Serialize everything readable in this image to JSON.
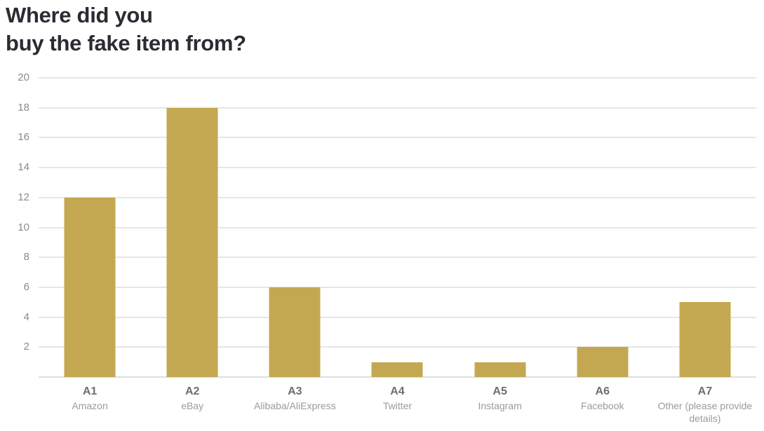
{
  "title": "Where did you\nbuy the fake item from?",
  "colors": {
    "bar": "#c4a851",
    "title_text": "#2b2b33",
    "gridline": "#e6e6e6",
    "axis_tick_text": "#8b8b8f",
    "category_code_text": "#6d6d75",
    "category_name_text": "#9a9aa1",
    "background": "#ffffff"
  },
  "yaxis": {
    "ticks": [
      "20",
      "18",
      "16",
      "14",
      "12",
      "10",
      "8",
      "6",
      "4",
      "2"
    ]
  },
  "categories": [
    {
      "code": "A1",
      "name": "Amazon"
    },
    {
      "code": "A2",
      "name": "eBay"
    },
    {
      "code": "A3",
      "name": "Alibaba/AliExpress"
    },
    {
      "code": "A4",
      "name": "Twitter"
    },
    {
      "code": "A5",
      "name": "Instagram"
    },
    {
      "code": "A6",
      "name": "Facebook"
    },
    {
      "code": "A7",
      "name": "Other (please provide details)"
    }
  ],
  "chart_data": {
    "type": "bar",
    "title": "Where did you buy the fake item from?",
    "xlabel": "",
    "ylabel": "",
    "categories": [
      "A1",
      "A2",
      "A3",
      "A4",
      "A5",
      "A6",
      "A7"
    ],
    "category_labels": [
      "A1 Amazon",
      "A2 eBay",
      "A3 Alibaba/AliExpress",
      "A4 Twitter",
      "A5 Instagram",
      "A6 Facebook",
      "A7 Other (please provide details)"
    ],
    "values": [
      12,
      18,
      6,
      1,
      1,
      2,
      5
    ],
    "ylim": [
      0,
      20
    ],
    "ytick_values": [
      2,
      4,
      6,
      8,
      10,
      12,
      14,
      16,
      18,
      20
    ],
    "grid": true,
    "grid_axis": "y",
    "legend": false,
    "bar_color": "#c4a851"
  }
}
